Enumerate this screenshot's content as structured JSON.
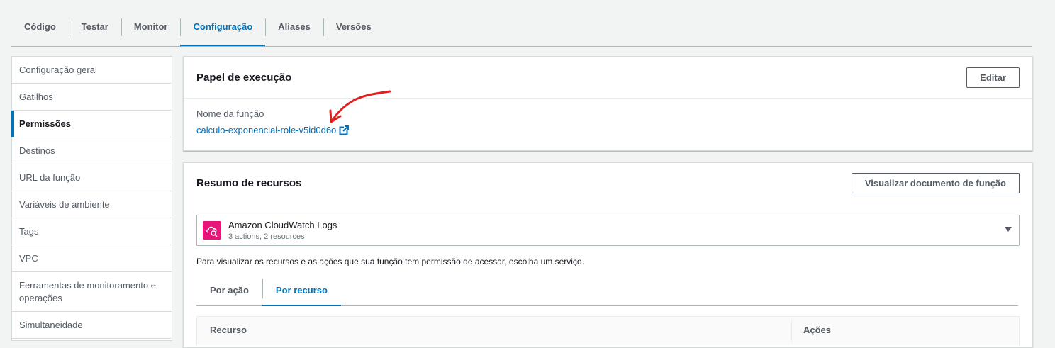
{
  "tabs": [
    {
      "label": "Código"
    },
    {
      "label": "Testar"
    },
    {
      "label": "Monitor"
    },
    {
      "label": "Configuração",
      "active": true
    },
    {
      "label": "Aliases"
    },
    {
      "label": "Versões"
    }
  ],
  "sidebar": {
    "items": [
      {
        "label": "Configuração geral"
      },
      {
        "label": "Gatilhos"
      },
      {
        "label": "Permissões",
        "active": true
      },
      {
        "label": "Destinos"
      },
      {
        "label": "URL da função"
      },
      {
        "label": "Variáveis de ambiente"
      },
      {
        "label": "Tags"
      },
      {
        "label": "VPC"
      },
      {
        "label": "Ferramentas de monitoramento e operações"
      },
      {
        "label": "Simultaneidade"
      }
    ]
  },
  "execution_role": {
    "title": "Papel de execução",
    "edit_label": "Editar",
    "role_label": "Nome da função",
    "role_name": "calculo-exponencial-role-v5id0d6o",
    "external_icon": "external-link-icon"
  },
  "resource_summary": {
    "title": "Resumo de recursos",
    "view_doc_label": "Visualizar documento de função",
    "service": {
      "name": "Amazon CloudWatch Logs",
      "description": "3 actions, 2 resources",
      "icon": "cloudwatch-logs-icon"
    },
    "help_text": "Para visualizar os recursos e as ações que sua função tem permissão de acessar, escolha um serviço.",
    "subtabs": [
      {
        "label": "Por ação"
      },
      {
        "label": "Por recurso",
        "active": true
      }
    ],
    "table": {
      "columns": [
        "Recurso",
        "Ações"
      ]
    }
  },
  "colors": {
    "accent": "#0073bb",
    "annotation": "#e01f1f",
    "service_icon": "#e7157b"
  }
}
